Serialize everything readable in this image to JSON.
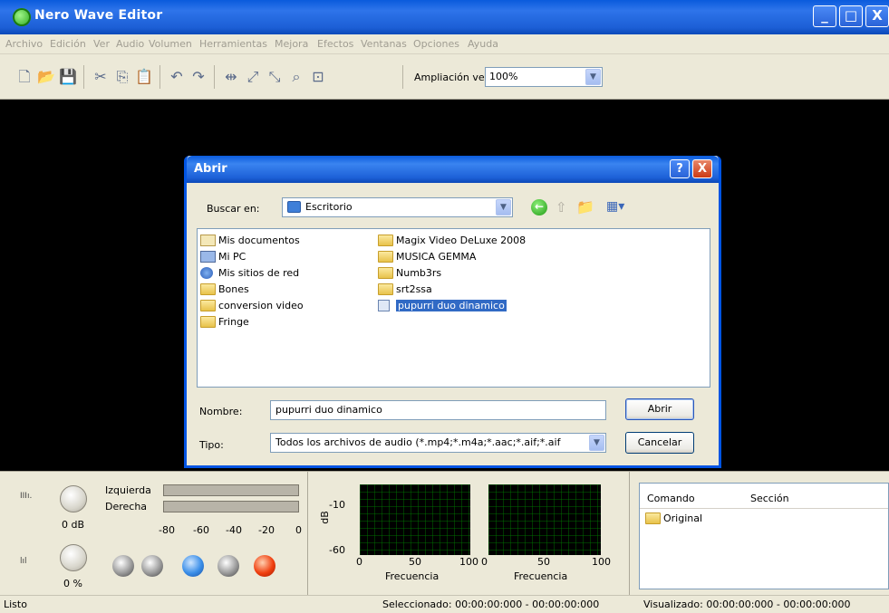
{
  "window": {
    "title": "Nero Wave Editor",
    "min": "_",
    "max": "□",
    "close": "X"
  },
  "menu": [
    "Archivo",
    "Edición",
    "Ver",
    "Audio",
    "Volumen",
    "Herramientas",
    "Mejora",
    "Efectos",
    "Ventanas",
    "Opciones",
    "Ayuda"
  ],
  "toolbar": {
    "icons": [
      "new-file-icon",
      "open-folder-icon",
      "save-icon",
      "cut-icon",
      "copy-icon",
      "paste-icon",
      "undo-icon",
      "redo-icon",
      "fit-width-icon",
      "zoom-in-icon",
      "zoom-out-icon",
      "zoom-selection-icon",
      "zoom-reset-icon"
    ],
    "zoom_label": "Ampliación vertical",
    "zoom_value": "100%"
  },
  "dialog": {
    "title": "Abrir",
    "help": "?",
    "close": "X",
    "look_in_label": "Buscar en:",
    "look_in_value": "Escritorio",
    "files_left": [
      {
        "name": "Mis documentos",
        "type": "documents"
      },
      {
        "name": "Mi PC",
        "type": "computer"
      },
      {
        "name": "Mis sitios de red",
        "type": "network"
      },
      {
        "name": "Bones",
        "type": "folder"
      },
      {
        "name": "conversion video",
        "type": "folder"
      },
      {
        "name": "Fringe",
        "type": "folder"
      }
    ],
    "files_right": [
      {
        "name": "Magix Video DeLuxe 2008",
        "type": "folder"
      },
      {
        "name": "MUSICA GEMMA",
        "type": "folder"
      },
      {
        "name": "Numb3rs",
        "type": "folder"
      },
      {
        "name": "srt2ssa",
        "type": "folder"
      },
      {
        "name": "pupurri duo dinamico",
        "type": "audio",
        "selected": true
      }
    ],
    "name_label": "Nombre:",
    "name_value": "pupurri duo dinamico",
    "type_label": "Tipo:",
    "type_value": "Todos los archivos de audio (*.mp4;*.m4a;*.aac;*.aif;*.aif",
    "open_button": "Abrir",
    "cancel_button": "Cancelar"
  },
  "levels": {
    "left_label": "Izquierda",
    "right_label": "Derecha",
    "scale": [
      "-80",
      "-60",
      "-40",
      "-20",
      "0"
    ],
    "gain_value": "0 dB",
    "pan_value": "0 %"
  },
  "spectrum": {
    "y_label": "dB",
    "y_ticks": [
      "-10",
      "-60"
    ],
    "x_ticks_left": [
      "0",
      "50",
      "100"
    ],
    "x_ticks_right": [
      "0",
      "50",
      "100"
    ],
    "x_label": "Frecuencia"
  },
  "history": {
    "col_command": "Comando",
    "col_section": "Sección",
    "items": [
      "Original"
    ]
  },
  "status": {
    "left": "Listo",
    "selected": "Seleccionado: 00:00:00:000 - 00:00:00:000",
    "visible": "Visualizado: 00:00:00:000 - 00:00:00:000"
  }
}
